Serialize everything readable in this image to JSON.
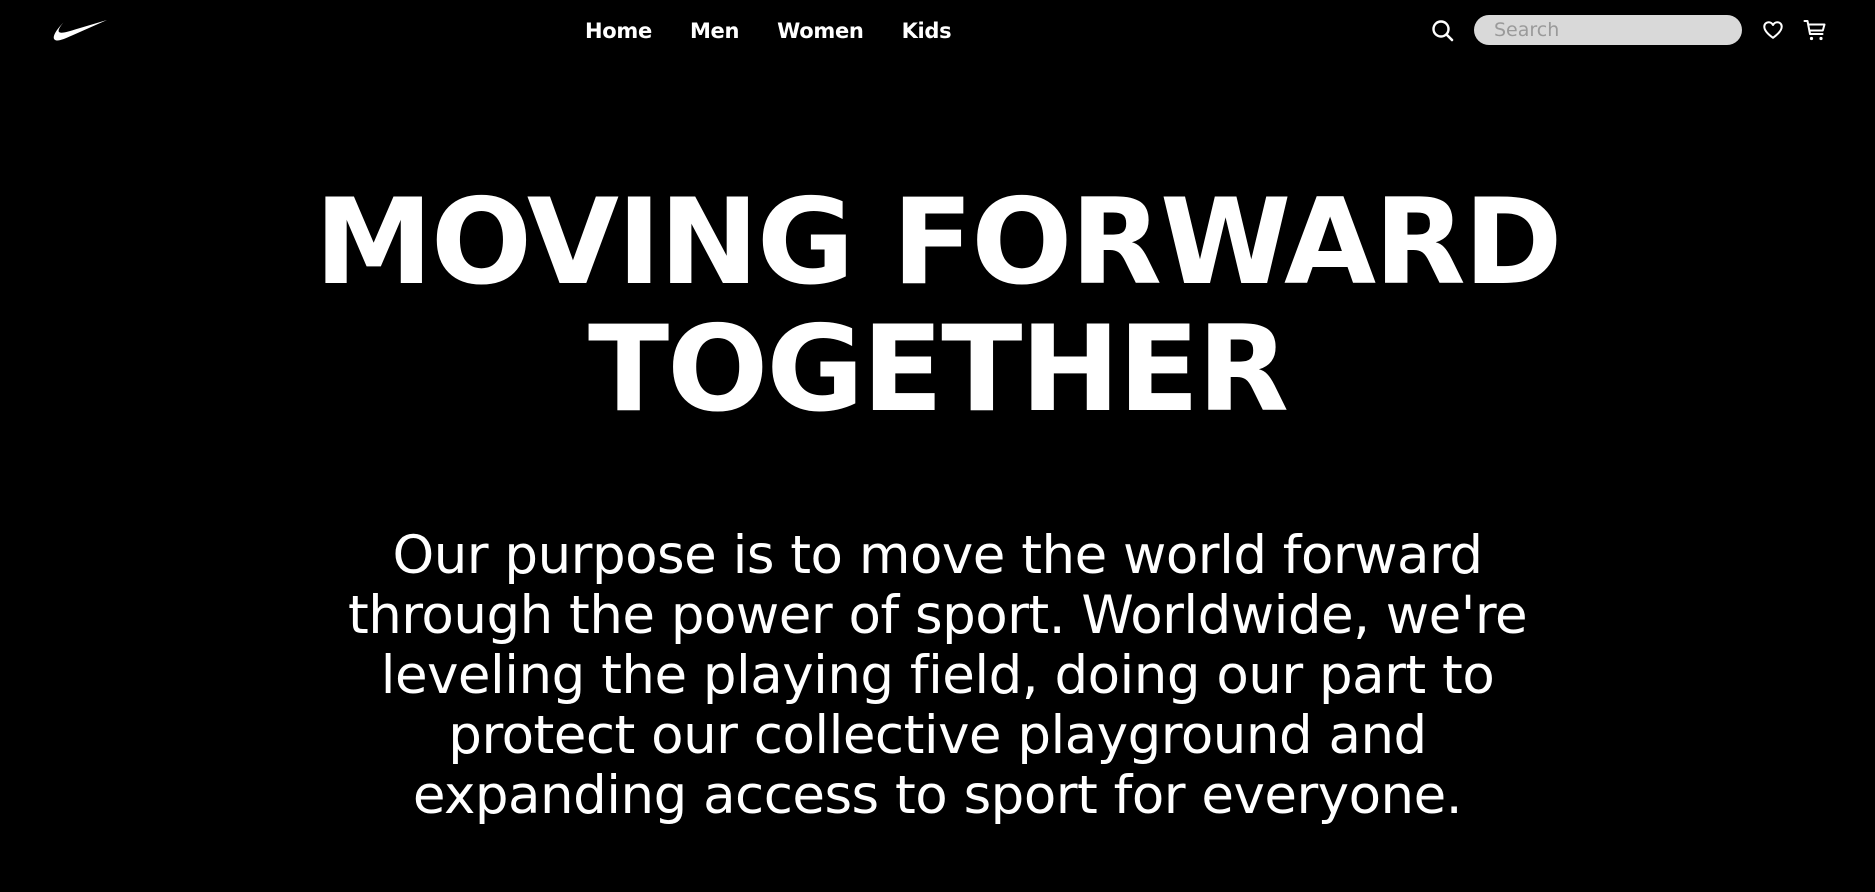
{
  "brand": {
    "logo_icon": "swoosh-icon",
    "logo_color": "#ffffff"
  },
  "nav": {
    "links": [
      {
        "label": "Home"
      },
      {
        "label": "Men"
      },
      {
        "label": "Women"
      },
      {
        "label": "Kids"
      }
    ]
  },
  "search": {
    "icon": "search-icon",
    "placeholder": "Search",
    "value": ""
  },
  "actions": {
    "favorites_icon": "heart-icon",
    "cart_icon": "cart-icon"
  },
  "hero": {
    "title_line1": "MOVING FORWARD",
    "title_line2": "TOGETHER",
    "body": "Our purpose is to move the world forward through the power of sport. Worldwide, we're leveling the playing field, doing our part to protect our collective playground and expanding access to sport for everyone."
  },
  "colors": {
    "background": "#000000",
    "text": "#ffffff",
    "search_bg": "#d9d9d9"
  }
}
